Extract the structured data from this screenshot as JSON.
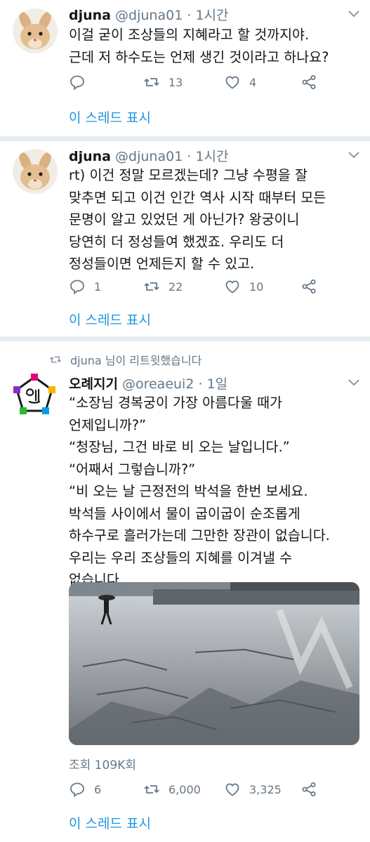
{
  "tweets": [
    {
      "author_name": "djuna",
      "author_handle": "@djuna01",
      "separator": "·",
      "time": "1시간",
      "lines": [
        "이걸 굳이 조상들의 지혜라고 할 것까지야.",
        "근데 저 하수도는 언제 생긴 것이라고 하나요?"
      ],
      "reply_count": "",
      "retweet_count": "13",
      "like_count": "4",
      "thread_link": "이 스레드 표시"
    },
    {
      "author_name": "djuna",
      "author_handle": "@djuna01",
      "separator": "·",
      "time": "1시간",
      "lines": [
        "rt) 이건 정말 모르겠는데? 그냥 수평을 잘",
        "맞추면 되고 이건 인간 역사 시작 때부터 모든",
        "문명이 알고 있었던 게 아닌가? 왕궁이니",
        "당연히 더 정성들여 했겠죠. 우리도 더",
        "정성들이면 언제든지 할 수 있고."
      ],
      "reply_count": "1",
      "retweet_count": "22",
      "like_count": "10",
      "thread_link": "이 스레드 표시"
    },
    {
      "retweet_notice": "djuna 님이 리트윗했습니다",
      "author_name": "오례지기",
      "author_handle": "@oreaeui2",
      "separator": "·",
      "time": "1일",
      "lines": [
        "“소장님 경복궁이 가장 아름다울 때가",
        "언제입니까?”",
        "“청장님, 그건 바로 비 오는 날입니다.”",
        "“어째서 그렇습니까?”",
        "“비 오는 날 근정전의 박석을 한번 보세요.",
        "박석들 사이에서 물이 굽이굽이 순조롭게",
        "하수구로 흘러가는데 그만한 장관이 없습니다.",
        "우리는 우리 조상들의 지혜를 이겨낼 수",
        "없습니다."
      ],
      "views": "조회 109K회",
      "reply_count": "6",
      "retweet_count": "6,000",
      "like_count": "3,325",
      "thread_link": "이 스레드 표시"
    }
  ],
  "colors": {
    "link": "#1b95e0",
    "secondary_text": "#657786",
    "divider": "#e6ecf0",
    "logo_colors": [
      "#e6007e",
      "#f7b500",
      "#00a0e9",
      "#2eb82e",
      "#1a1a1a"
    ]
  },
  "icons": [
    "reply-icon",
    "retweet-icon",
    "like-icon",
    "share-icon",
    "chevron-down-icon"
  ]
}
